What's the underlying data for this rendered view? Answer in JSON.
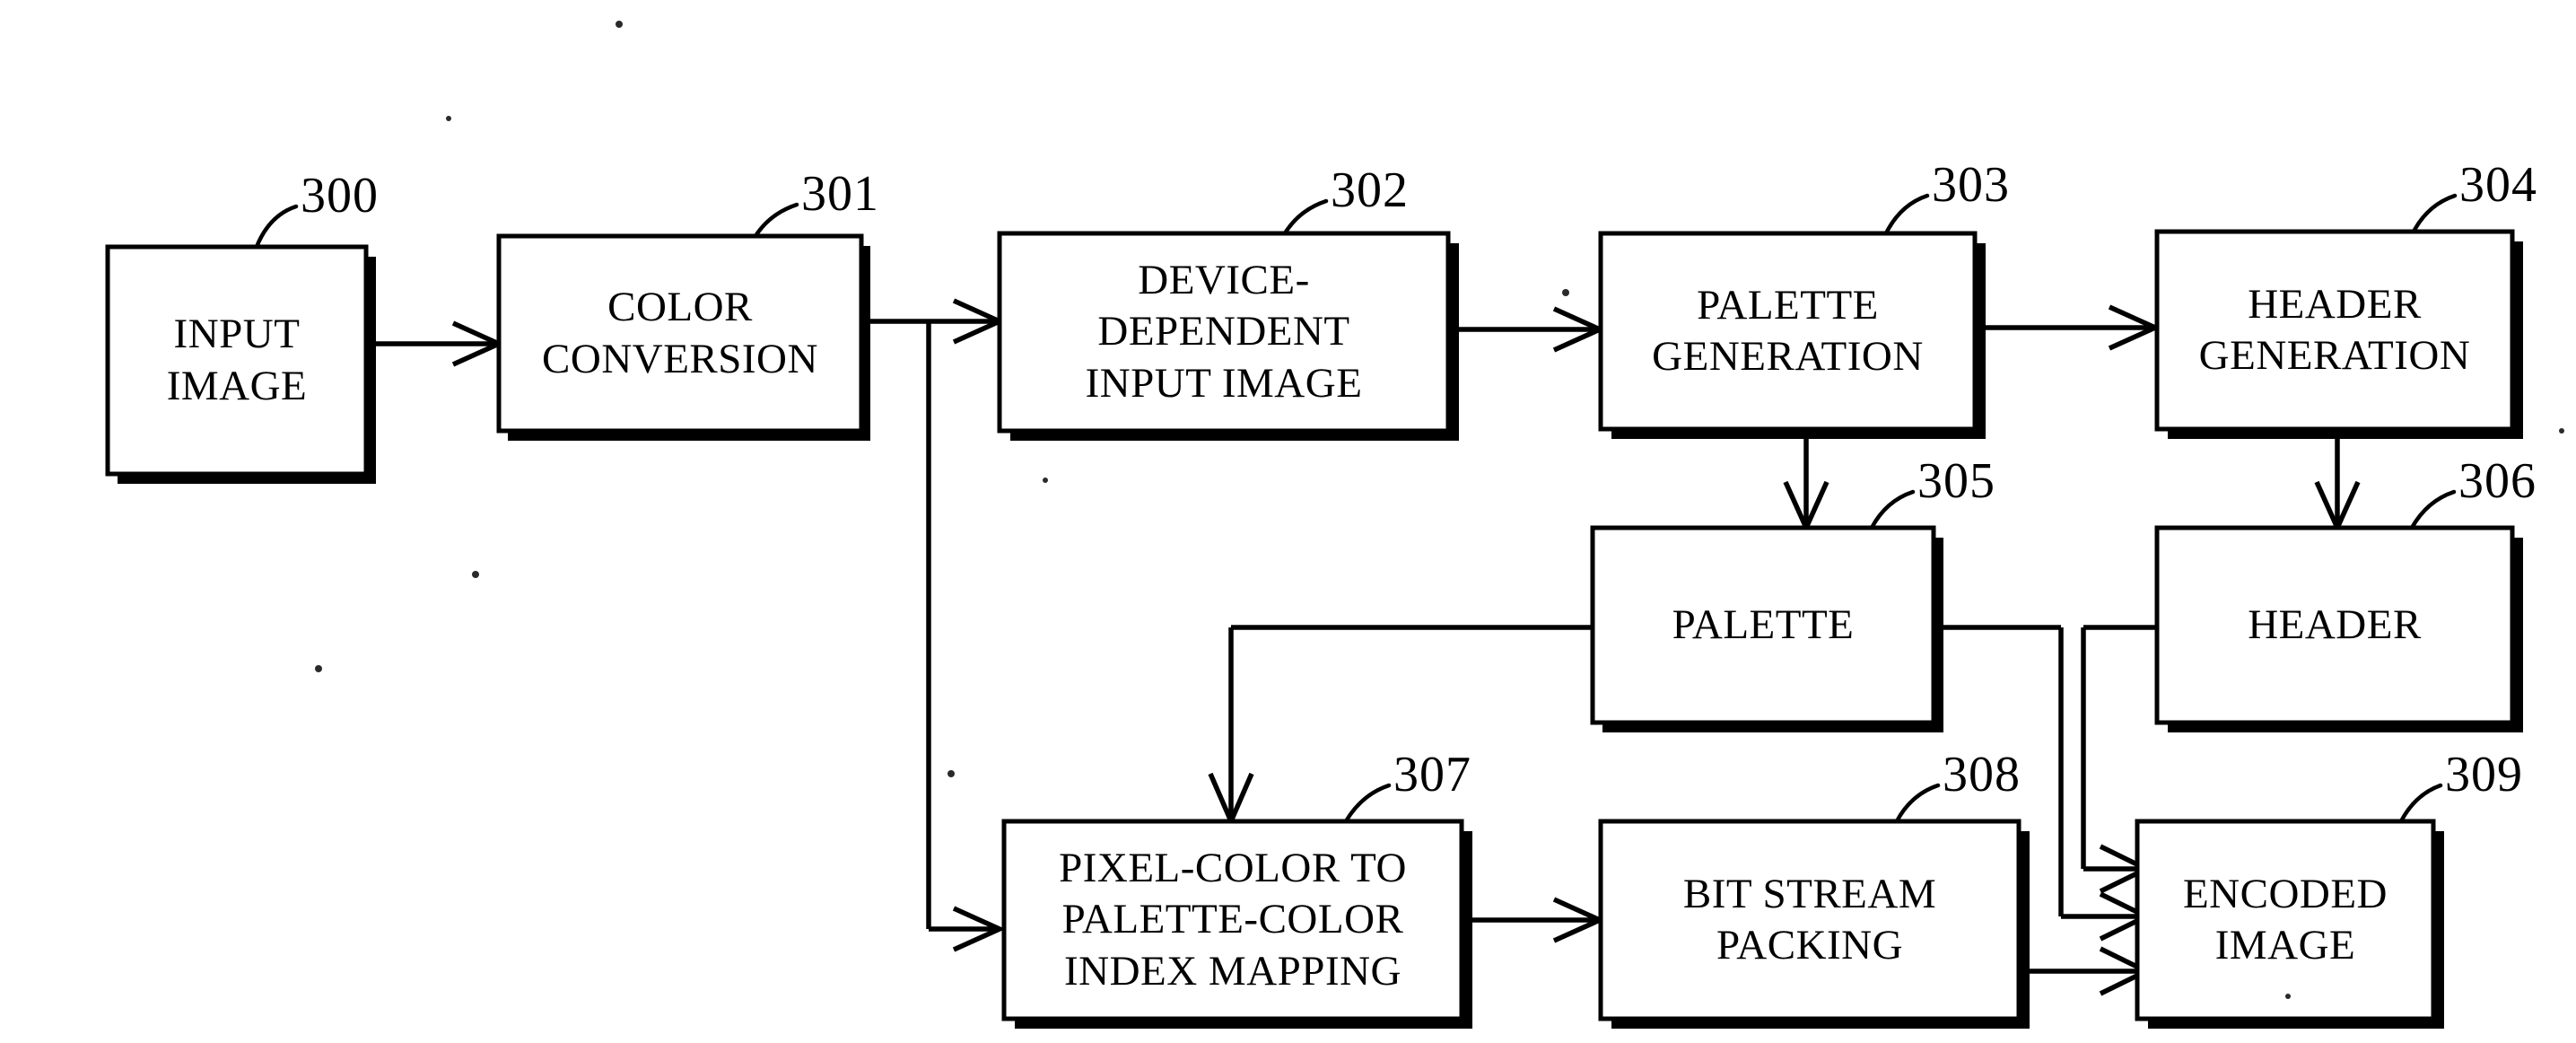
{
  "figure": {
    "type": "patent-block-diagram",
    "background_color": "#ffffff",
    "line_color": "#000000"
  },
  "blocks": [
    {
      "ref": "300",
      "lines": [
        "INPUT",
        "IMAGE"
      ],
      "line1": "INPUT",
      "line2": "IMAGE",
      "line3": ""
    },
    {
      "ref": "301",
      "lines": [
        "COLOR",
        "CONVERSION"
      ],
      "line1": "COLOR",
      "line2": "CONVERSION",
      "line3": ""
    },
    {
      "ref": "302",
      "lines": [
        "DEVICE-",
        "DEPENDENT",
        "INPUT IMAGE"
      ],
      "line1": "DEVICE-",
      "line2": "DEPENDENT",
      "line3": "INPUT IMAGE"
    },
    {
      "ref": "303",
      "lines": [
        "PALETTE",
        "GENERATION"
      ],
      "line1": "PALETTE",
      "line2": "GENERATION",
      "line3": ""
    },
    {
      "ref": "304",
      "lines": [
        "HEADER",
        "GENERATION"
      ],
      "line1": "HEADER",
      "line2": "GENERATION",
      "line3": ""
    },
    {
      "ref": "305",
      "lines": [
        "PALETTE"
      ],
      "line1": "PALETTE",
      "line2": "",
      "line3": ""
    },
    {
      "ref": "306",
      "lines": [
        "HEADER"
      ],
      "line1": "HEADER",
      "line2": "",
      "line3": ""
    },
    {
      "ref": "307",
      "lines": [
        "PIXEL-COLOR TO",
        "PALETTE-COLOR",
        "INDEX MAPPING"
      ],
      "line1": "PIXEL-COLOR TO",
      "line2": "PALETTE-COLOR",
      "line3": "INDEX MAPPING"
    },
    {
      "ref": "308",
      "lines": [
        "BIT STREAM",
        "PACKING"
      ],
      "line1": "BIT STREAM",
      "line2": "PACKING",
      "line3": ""
    },
    {
      "ref": "309",
      "lines": [
        "ENCODED",
        "IMAGE"
      ],
      "line1": "ENCODED",
      "line2": "IMAGE",
      "line3": ""
    }
  ],
  "reference_numerals": {
    "n300": "300",
    "n301": "301",
    "n302": "302",
    "n303": "303",
    "n304": "304",
    "n305": "305",
    "n306": "306",
    "n307": "307",
    "n308": "308",
    "n309": "309"
  },
  "connections": [
    {
      "from": "300",
      "to": "301",
      "style": "arrow-right"
    },
    {
      "from": "301",
      "to": "302",
      "style": "arrow-right"
    },
    {
      "from": "301",
      "to": "307",
      "style": "branch-down-then-right-arrow"
    },
    {
      "from": "302",
      "to": "303",
      "style": "arrow-right"
    },
    {
      "from": "303",
      "to": "304",
      "style": "arrow-right"
    },
    {
      "from": "303",
      "to": "305",
      "style": "arrow-down"
    },
    {
      "from": "304",
      "to": "306",
      "style": "arrow-down"
    },
    {
      "from": "305",
      "to": "307",
      "style": "left-then-down-arrow"
    },
    {
      "from": "305",
      "to": "309",
      "style": "right-then-down-then-right-arrow"
    },
    {
      "from": "306",
      "to": "309",
      "style": "left-then-down-then-right-arrow"
    },
    {
      "from": "307",
      "to": "308",
      "style": "arrow-right"
    },
    {
      "from": "308",
      "to": "309",
      "style": "arrow-right"
    }
  ]
}
